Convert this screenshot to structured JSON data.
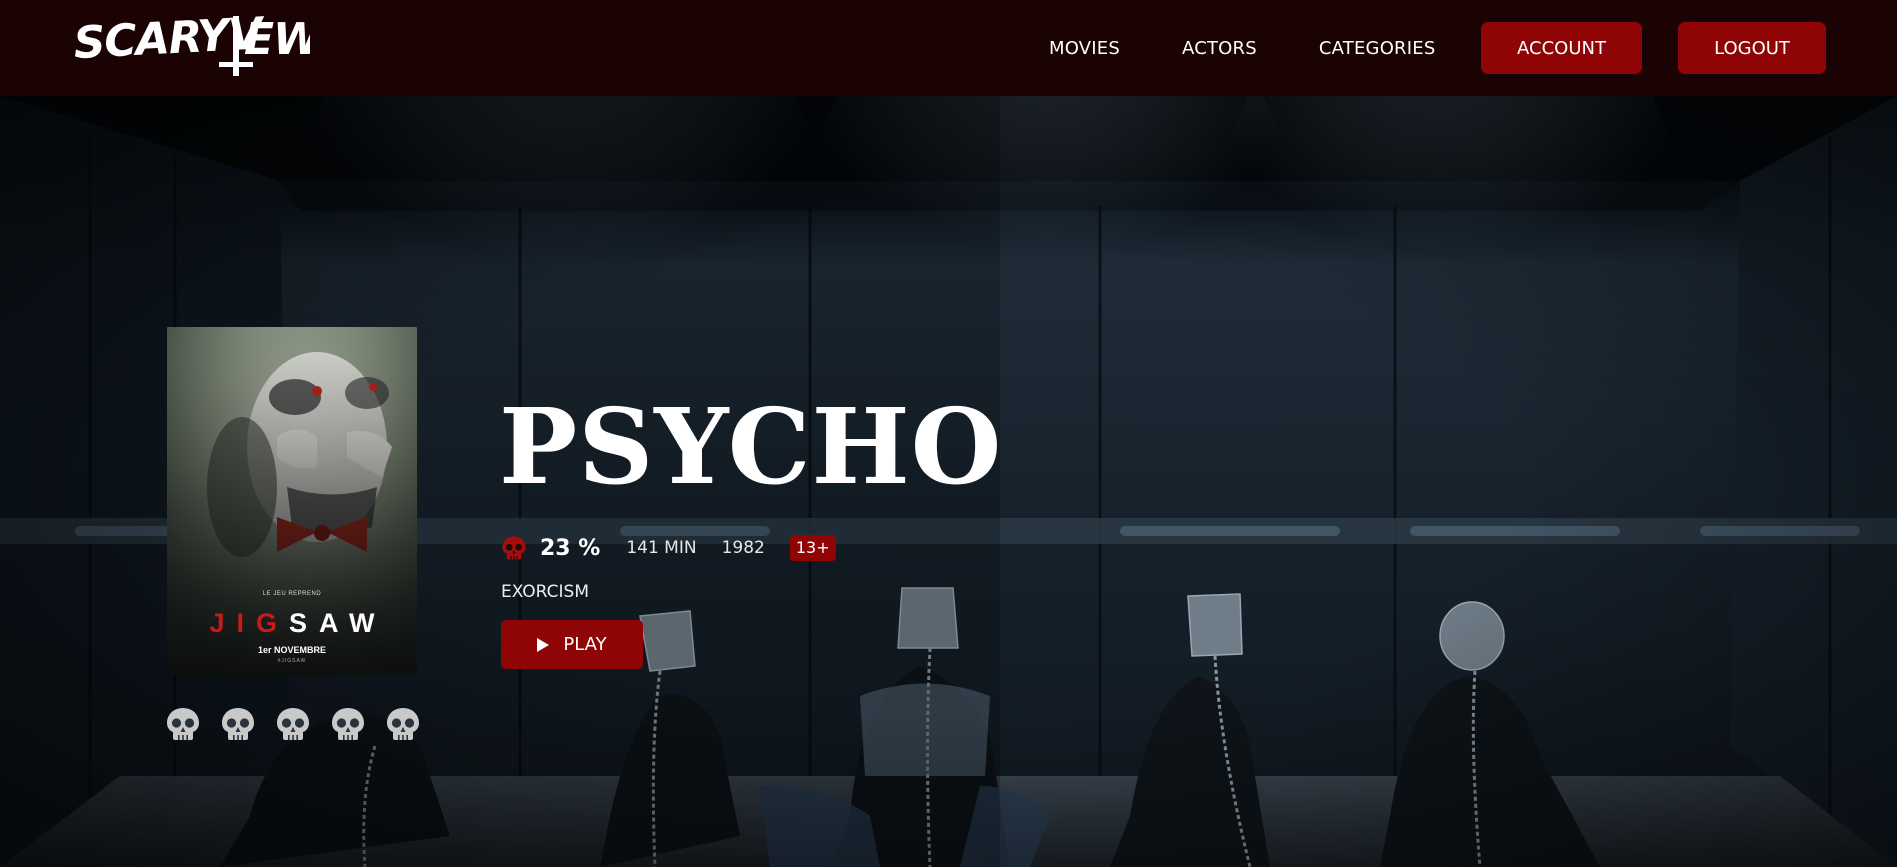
{
  "brand": {
    "logo_text": "SCARYVIEW"
  },
  "nav": {
    "links": [
      "MOVIES",
      "ACTORS",
      "CATEGORIES"
    ],
    "account_label": "ACCOUNT",
    "logout_label": "LOGOUT"
  },
  "poster": {
    "tagline": "LE JEU REPREND",
    "title_red": "JIG",
    "title_white": "SAW",
    "date": "1er NOVEMBRE",
    "hashtag": "#JIGSAW"
  },
  "movie": {
    "title": "PSYCHO",
    "score": "23 %",
    "duration": "141 MIN",
    "year": "1982",
    "age_rating": "13+",
    "genre": "EXORCISM",
    "play_label": "PLAY"
  },
  "rating": {
    "max": 5
  },
  "icons": {
    "score": "skull-icon",
    "play": "play-icon",
    "rating": "skull-icon"
  },
  "colors": {
    "nav_bg": "#1c0303",
    "accent": "#8f0505",
    "score_skull": "#a70d0d",
    "rating_skull": "#c9c9c9"
  }
}
